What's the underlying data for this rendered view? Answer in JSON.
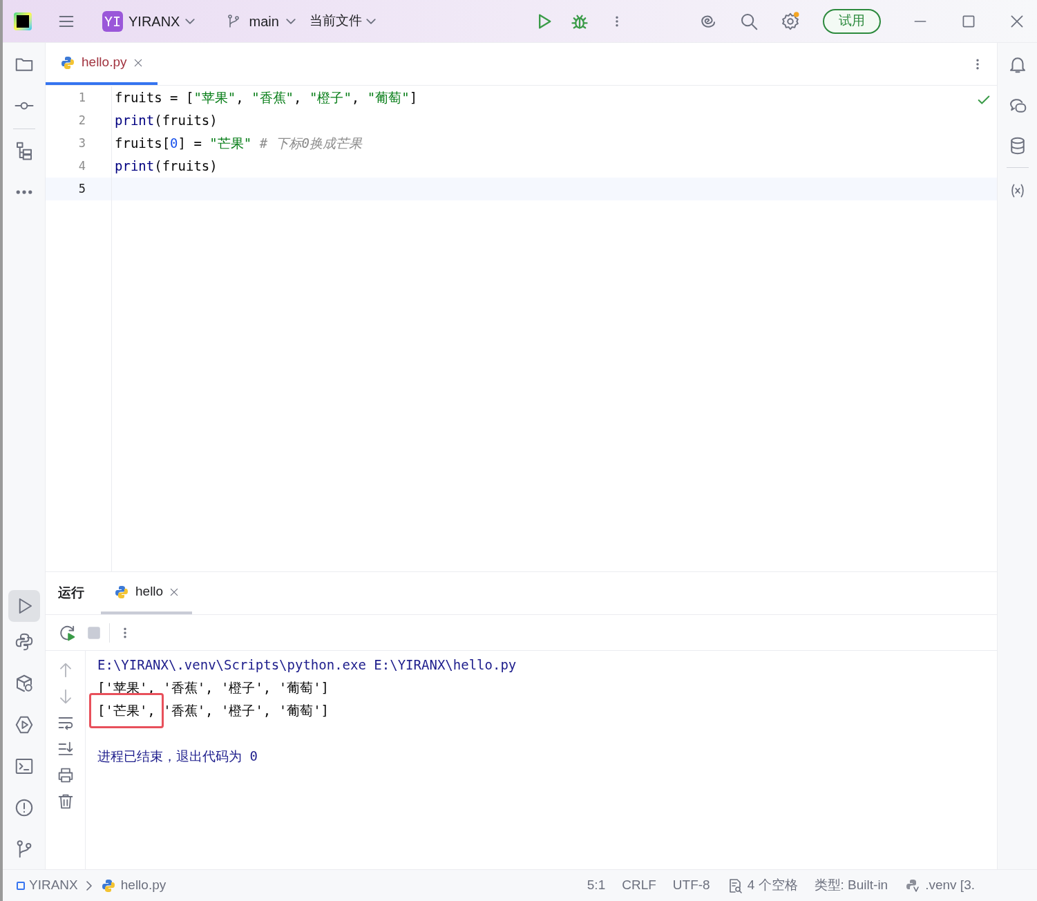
{
  "title_bar": {
    "project_badge": "YI",
    "project": "YIRANX",
    "branch": "main",
    "run_config": "当前文件",
    "trial_button": "试用"
  },
  "editor_tabs": [
    {
      "label": "hello.py",
      "selected": true
    }
  ],
  "code_lines": [
    {
      "number": "1",
      "current": false,
      "tokens": [
        {
          "text": "fruits = [",
          "kind": "plain"
        },
        {
          "text": "\"苹果\"",
          "kind": "string"
        },
        {
          "text": ", ",
          "kind": "plain"
        },
        {
          "text": "\"香蕉\"",
          "kind": "string"
        },
        {
          "text": ", ",
          "kind": "plain"
        },
        {
          "text": "\"橙子\"",
          "kind": "string"
        },
        {
          "text": ", ",
          "kind": "plain"
        },
        {
          "text": "\"葡萄\"",
          "kind": "string"
        },
        {
          "text": "]",
          "kind": "plain"
        }
      ]
    },
    {
      "number": "2",
      "current": false,
      "tokens": [
        {
          "text": "print",
          "kind": "builtin"
        },
        {
          "text": "(fruits)",
          "kind": "plain"
        }
      ]
    },
    {
      "number": "3",
      "current": false,
      "tokens": [
        {
          "text": "fruits[",
          "kind": "plain"
        },
        {
          "text": "0",
          "kind": "number"
        },
        {
          "text": "] = ",
          "kind": "plain"
        },
        {
          "text": "\"芒果\"",
          "kind": "string"
        },
        {
          "text": "# 下标0换成芒果",
          "kind": "comment"
        }
      ]
    },
    {
      "number": "4",
      "current": false,
      "tokens": [
        {
          "text": "print",
          "kind": "builtin"
        },
        {
          "text": "(fruits)",
          "kind": "plain"
        }
      ]
    },
    {
      "number": "5",
      "current": true
    }
  ],
  "run_panel": {
    "title": "运行",
    "tabs": [
      {
        "label": "hello",
        "selected": true
      }
    ],
    "output": [
      {
        "kind": "system",
        "tokens": [
          {
            "text": "E:\\YIRANX\\.venv\\Scripts\\python.exe E:\\YIRANX\\hello.py",
            "highlighted": false
          }
        ]
      },
      {
        "kind": "stdout",
        "tokens": [
          {
            "text": "['苹果', '香蕉', '橙子', '葡萄']",
            "highlighted": false
          }
        ]
      },
      {
        "kind": "stdout",
        "tokens": [
          {
            "text": "['芒果',",
            "highlighted": true
          },
          {
            "text": " '香蕉', '橙子', '葡萄']",
            "highlighted": false
          }
        ]
      },
      {
        "kind": "blank"
      },
      {
        "kind": "system",
        "tokens": [
          {
            "text": "进程已结束，退出代码为 0",
            "highlighted": false
          }
        ]
      }
    ]
  },
  "status_bar": {
    "breadcrumbs": [
      {
        "label": "YIRANX",
        "kind": "project"
      },
      {
        "label": "hello.py",
        "kind": "file"
      }
    ],
    "items": [
      {
        "label": "5:1",
        "kind": "text"
      },
      {
        "label": "CRLF",
        "kind": "text"
      },
      {
        "label": "UTF-8",
        "kind": "text"
      },
      {
        "label": "4 个空格",
        "kind": "indent"
      },
      {
        "label": "类型: Built-in",
        "kind": "text"
      },
      {
        "label": ".venv [3.",
        "kind": "interpreter"
      }
    ]
  }
}
